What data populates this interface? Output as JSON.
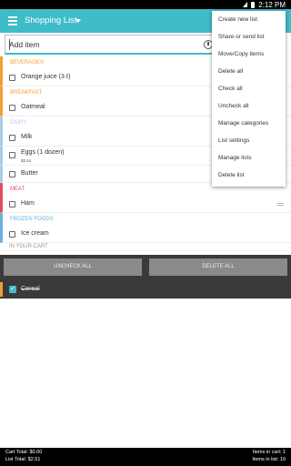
{
  "status": {
    "time": "2:12 PM"
  },
  "appbar": {
    "title": "Shopping List"
  },
  "add": {
    "placeholder": "Add item"
  },
  "categories": [
    {
      "name": "BEVERAGES",
      "color": "#f0a030",
      "items": [
        {
          "label": "Orange juice (3 ℓ)",
          "sub": ""
        }
      ]
    },
    {
      "name": "BREAKFAST",
      "color": "#f0a030",
      "items": [
        {
          "label": "Oatmeal",
          "sub": ""
        }
      ]
    },
    {
      "name": "DAIRY",
      "color": "#a9cdea",
      "items": [
        {
          "label": "Milk",
          "sub": ""
        },
        {
          "label": "Eggs (1 dozen)",
          "sub": "$2.51"
        },
        {
          "label": "Butter",
          "sub": ""
        }
      ]
    },
    {
      "name": "MEAT",
      "color": "#e05060",
      "items": [
        {
          "label": "Ham",
          "sub": ""
        }
      ]
    },
    {
      "name": "FROZEN FOODS",
      "color": "#6ab0e0",
      "items": [
        {
          "label": "Ice cream",
          "sub": ""
        }
      ]
    }
  ],
  "cart": {
    "header": "IN YOUR CART",
    "uncheck_all": "UNCHECK ALL",
    "delete_all": "DELETE ALL",
    "items": [
      {
        "label": "Cereal"
      }
    ]
  },
  "footer": {
    "cart_total": "Cart Total: $0.00",
    "list_total": "List Total: $2.51",
    "items_in_cart": "Items in cart: 1",
    "items_in_list": "Items in list: 10"
  },
  "menu": {
    "items": [
      "Create new list",
      "Share or send list",
      "Move/Copy items",
      "Delete all",
      "Check all",
      "Uncheck all",
      "Manage categories",
      "List settings",
      "Manage lists",
      "Delete list"
    ]
  },
  "icons": {
    "menu": "hamburger-icon",
    "dropdown": "caret-down-icon",
    "history": "clock-icon",
    "checkbox": "checkbox-icon",
    "drag": "drag-handle-icon"
  },
  "colors": {
    "accent": "#3fbcc8",
    "cart_bg": "#3a3a3a"
  }
}
